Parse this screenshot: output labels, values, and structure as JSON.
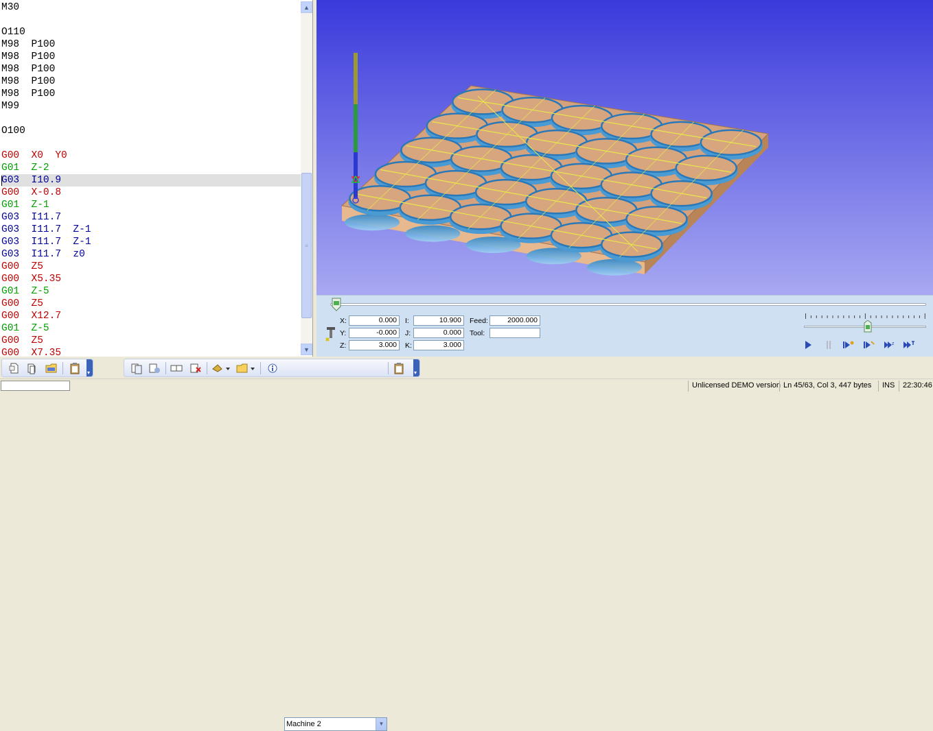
{
  "editor": {
    "lines": [
      {
        "text": "M30",
        "color": "black"
      },
      {
        "text": "",
        "color": "black"
      },
      {
        "text": "O110",
        "color": "black"
      },
      {
        "text": "M98  P100",
        "color": "black"
      },
      {
        "text": "M98  P100",
        "color": "black"
      },
      {
        "text": "M98  P100",
        "color": "black"
      },
      {
        "text": "M98  P100",
        "color": "black"
      },
      {
        "text": "M98  P100",
        "color": "black"
      },
      {
        "text": "M99",
        "color": "black"
      },
      {
        "text": "",
        "color": "black"
      },
      {
        "text": "O100",
        "color": "black"
      },
      {
        "text": "",
        "color": "black"
      },
      {
        "text": "G00  X0  Y0",
        "color": "red"
      },
      {
        "text": "G01  Z-2",
        "color": "green"
      },
      {
        "text": "G03  I10.9",
        "color": "blue",
        "current": true
      },
      {
        "text": "G00  X-0.8",
        "color": "red"
      },
      {
        "text": "G01  Z-1",
        "color": "green"
      },
      {
        "text": "G03  I11.7",
        "color": "blue"
      },
      {
        "text": "G03  I11.7  Z-1",
        "color": "blue"
      },
      {
        "text": "G03  I11.7  Z-1",
        "color": "blue"
      },
      {
        "text": "G03  I11.7  z0",
        "color": "blue"
      },
      {
        "text": "G00  Z5",
        "color": "red"
      },
      {
        "text": "G00  X5.35",
        "color": "red"
      },
      {
        "text": "G01  Z-5",
        "color": "green"
      },
      {
        "text": "G00  Z5",
        "color": "red"
      },
      {
        "text": "G00  X12.7",
        "color": "red"
      },
      {
        "text": "G01  Z-5",
        "color": "green"
      },
      {
        "text": "G00  Z5",
        "color": "red"
      },
      {
        "text": "G00  X7.35",
        "color": "red"
      }
    ]
  },
  "controls": {
    "x_label": "X:",
    "x_value": "0.000",
    "y_label": "Y:",
    "y_value": "-0.000",
    "z_label": "Z:",
    "z_value": "3.000",
    "i_label": "I:",
    "i_value": "10.900",
    "j_label": "J:",
    "j_value": "0.000",
    "k_label": "K:",
    "k_value": "3.000",
    "feed_label": "Feed:",
    "feed_value": "2000.000",
    "tool_label": "Tool:",
    "tool_value": "",
    "timeline_progress": 0.01,
    "speed_level": 0.52
  },
  "toolbar": {
    "machine_select": "Machine 2",
    "icons": [
      "new-file-icon",
      "copy-icon",
      "open-folder-icon",
      "clipboard-icon",
      "compare-icon",
      "transfer-icon",
      "send-icon",
      "receive-icon",
      "tool-dropdown-icon",
      "folder-dropdown-icon",
      "info-icon",
      "machine-settings-icon"
    ]
  },
  "statusbar": {
    "license": "Unlicensed DEMO version",
    "position": "Ln 45/63, Col 3, 447 bytes",
    "mode": "INS",
    "time": "22:30:46"
  },
  "colors": {
    "viewport_top": "#3b3bdb",
    "viewport_bottom": "#a6a6f0",
    "stock": "#d4a27c",
    "toolpath": "#e8e84a",
    "cut": "#4a9ad4"
  }
}
